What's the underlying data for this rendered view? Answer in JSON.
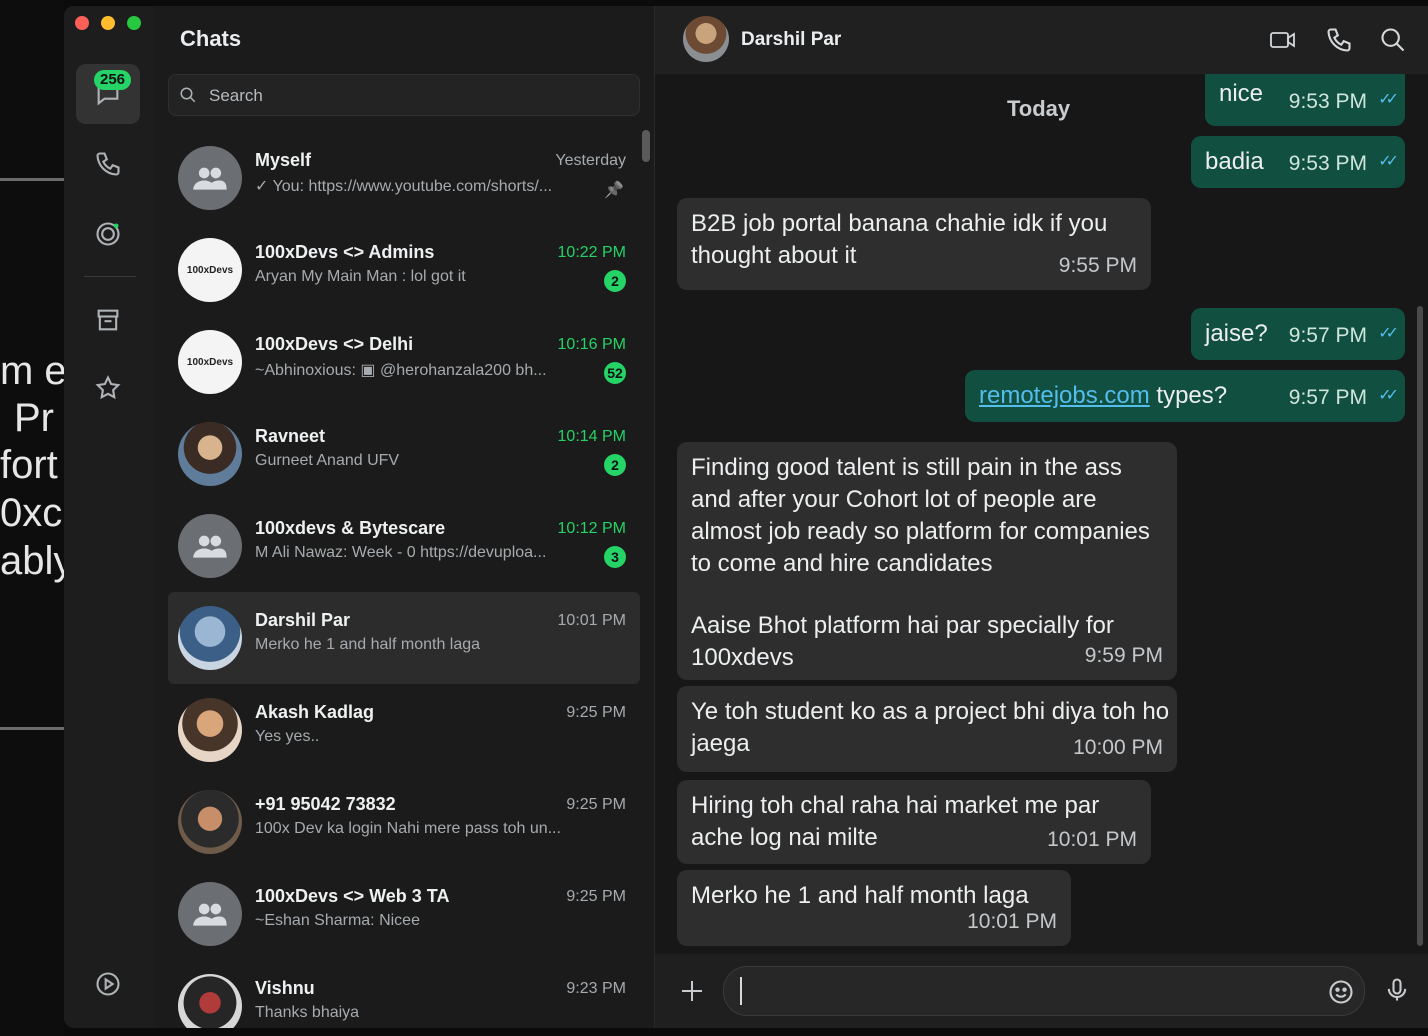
{
  "background_window": {
    "text_fragments": [
      "m e",
      "Pr",
      "fort",
      "0xc",
      "ably"
    ]
  },
  "rail": {
    "chats_badge": "256",
    "icons": [
      "chats-icon",
      "calls-icon",
      "status-icon",
      "archive-icon",
      "starred-icon",
      "settings-icon"
    ]
  },
  "list": {
    "title": "Chats",
    "search_placeholder": "Search",
    "chats": [
      {
        "name": "Myself",
        "preview": "✓ You: https://www.youtube.com/shorts/...",
        "time": "Yesterday",
        "unread": "",
        "pinned": true,
        "avatar": "group"
      },
      {
        "name": "100xDevs <> Admins",
        "preview": "Aryan My Main Man : lol got it",
        "time": "10:22 PM",
        "unread": "2",
        "avatar": "logo",
        "logo_text": "100xDevs"
      },
      {
        "name": "100xDevs <> Delhi",
        "preview": "~Abhinoxious: ▣ @herohanzala200 bh...",
        "time": "10:16 PM",
        "unread": "52",
        "avatar": "logo",
        "logo_text": "100xDevs"
      },
      {
        "name": "Ravneet",
        "preview": "Gurneet Anand UFV",
        "time": "10:14 PM",
        "unread": "2",
        "avatar": "photo"
      },
      {
        "name": "100xdevs & Bytescare",
        "preview": "M Ali Nawaz: Week - 0 https://devuploa...",
        "time": "10:12 PM",
        "unread": "3",
        "avatar": "group"
      },
      {
        "name": "Darshil Par",
        "preview": "Merko he 1 and half month laga",
        "time": "10:01 PM",
        "unread": "",
        "avatar": "photo",
        "active": true
      },
      {
        "name": "Akash Kadlag",
        "preview": "Yes yes..",
        "time": "9:25 PM",
        "unread": "",
        "avatar": "photo"
      },
      {
        "name": "+91 95042 73832",
        "preview": "100x Dev ka login Nahi mere pass toh un...",
        "time": "9:25 PM",
        "unread": "",
        "avatar": "photo"
      },
      {
        "name": "100xDevs <> Web 3 TA",
        "preview": "~Eshan Sharma: Nicee",
        "time": "9:25 PM",
        "unread": "",
        "avatar": "group"
      },
      {
        "name": "Vishnu",
        "preview": "Thanks bhaiya",
        "time": "9:23 PM",
        "unread": "",
        "avatar": "photo"
      }
    ]
  },
  "conversation": {
    "contact_name": "Darshil Par",
    "day_separator": "Today",
    "messages": [
      {
        "dir": "out",
        "text": "nice",
        "time": "9:53 PM"
      },
      {
        "dir": "out",
        "text": "badia",
        "time": "9:53 PM"
      },
      {
        "dir": "in",
        "text": "B2B job portal banana chahie idk if you thought about it",
        "time": "9:55 PM"
      },
      {
        "dir": "out",
        "text": "jaise?",
        "time": "9:57 PM"
      },
      {
        "dir": "out",
        "link": "remotejobs.com",
        "text": " types?",
        "time": "9:57 PM"
      },
      {
        "dir": "in",
        "text": "Finding good talent is still pain in the ass and after your Cohort lot of people are almost job ready so platform for companies to come and hire candidates",
        "text2": "Aaise Bhot platform hai par specially for 100xdevs",
        "time": "9:59 PM"
      },
      {
        "dir": "in",
        "text": "Ye toh student ko as a project bhi diya toh ho jaega",
        "time": "10:00 PM"
      },
      {
        "dir": "in",
        "text": "Hiring toh chal raha hai market me par ache log nai milte",
        "time": "10:01 PM"
      },
      {
        "dir": "in",
        "text": "Merko he 1 and half month laga",
        "time": "10:01 PM"
      }
    ],
    "read_ticks": "✓✓"
  },
  "colors": {
    "accent": "#25d366",
    "outgoing_bubble": "#114f40",
    "incoming_bubble": "#2e2e2e",
    "link": "#53bdeb"
  }
}
